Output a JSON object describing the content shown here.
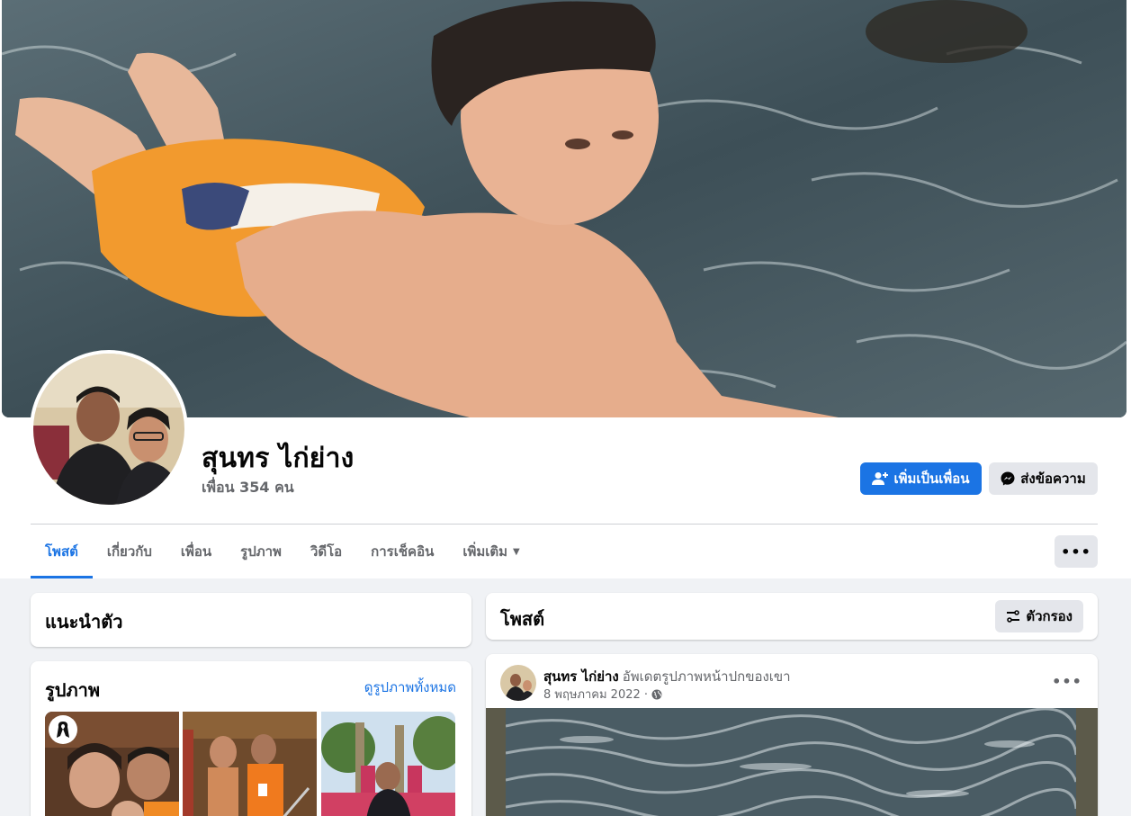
{
  "profile": {
    "name": "สุนทร ไก่ย่าง",
    "friends": "เพื่อน 354 คน"
  },
  "actions": {
    "add_friend": "เพิ่มเป็นเพื่อน",
    "message": "ส่งข้อความ",
    "more": "•••"
  },
  "tabs": [
    {
      "label": "โพสต์",
      "active": true
    },
    {
      "label": "เกี่ยวกับ"
    },
    {
      "label": "เพื่อน"
    },
    {
      "label": "รูปภาพ"
    },
    {
      "label": "วิดีโอ"
    },
    {
      "label": "การเช็คอิน"
    },
    {
      "label": "เพิ่มเติม"
    }
  ],
  "intro": {
    "title": "แนะนำตัว"
  },
  "photos": {
    "title": "รูปภาพ",
    "see_all": "ดูรูปภาพทั้งหมด"
  },
  "posts": {
    "title": "โพสต์",
    "filter": "ตัวกรอง"
  },
  "post": {
    "author": "สุนทร ไก่ย่าง",
    "action": "อัพเดตรูปภาพหน้าปกของเขา",
    "date": "8 พฤษภาคม 2022 ·",
    "more": "•••"
  },
  "colors": {
    "accent": "#1b74e4",
    "secondary_button": "#e4e6eb",
    "page_background": "#f0f2f5",
    "muted_text": "#65676b"
  }
}
